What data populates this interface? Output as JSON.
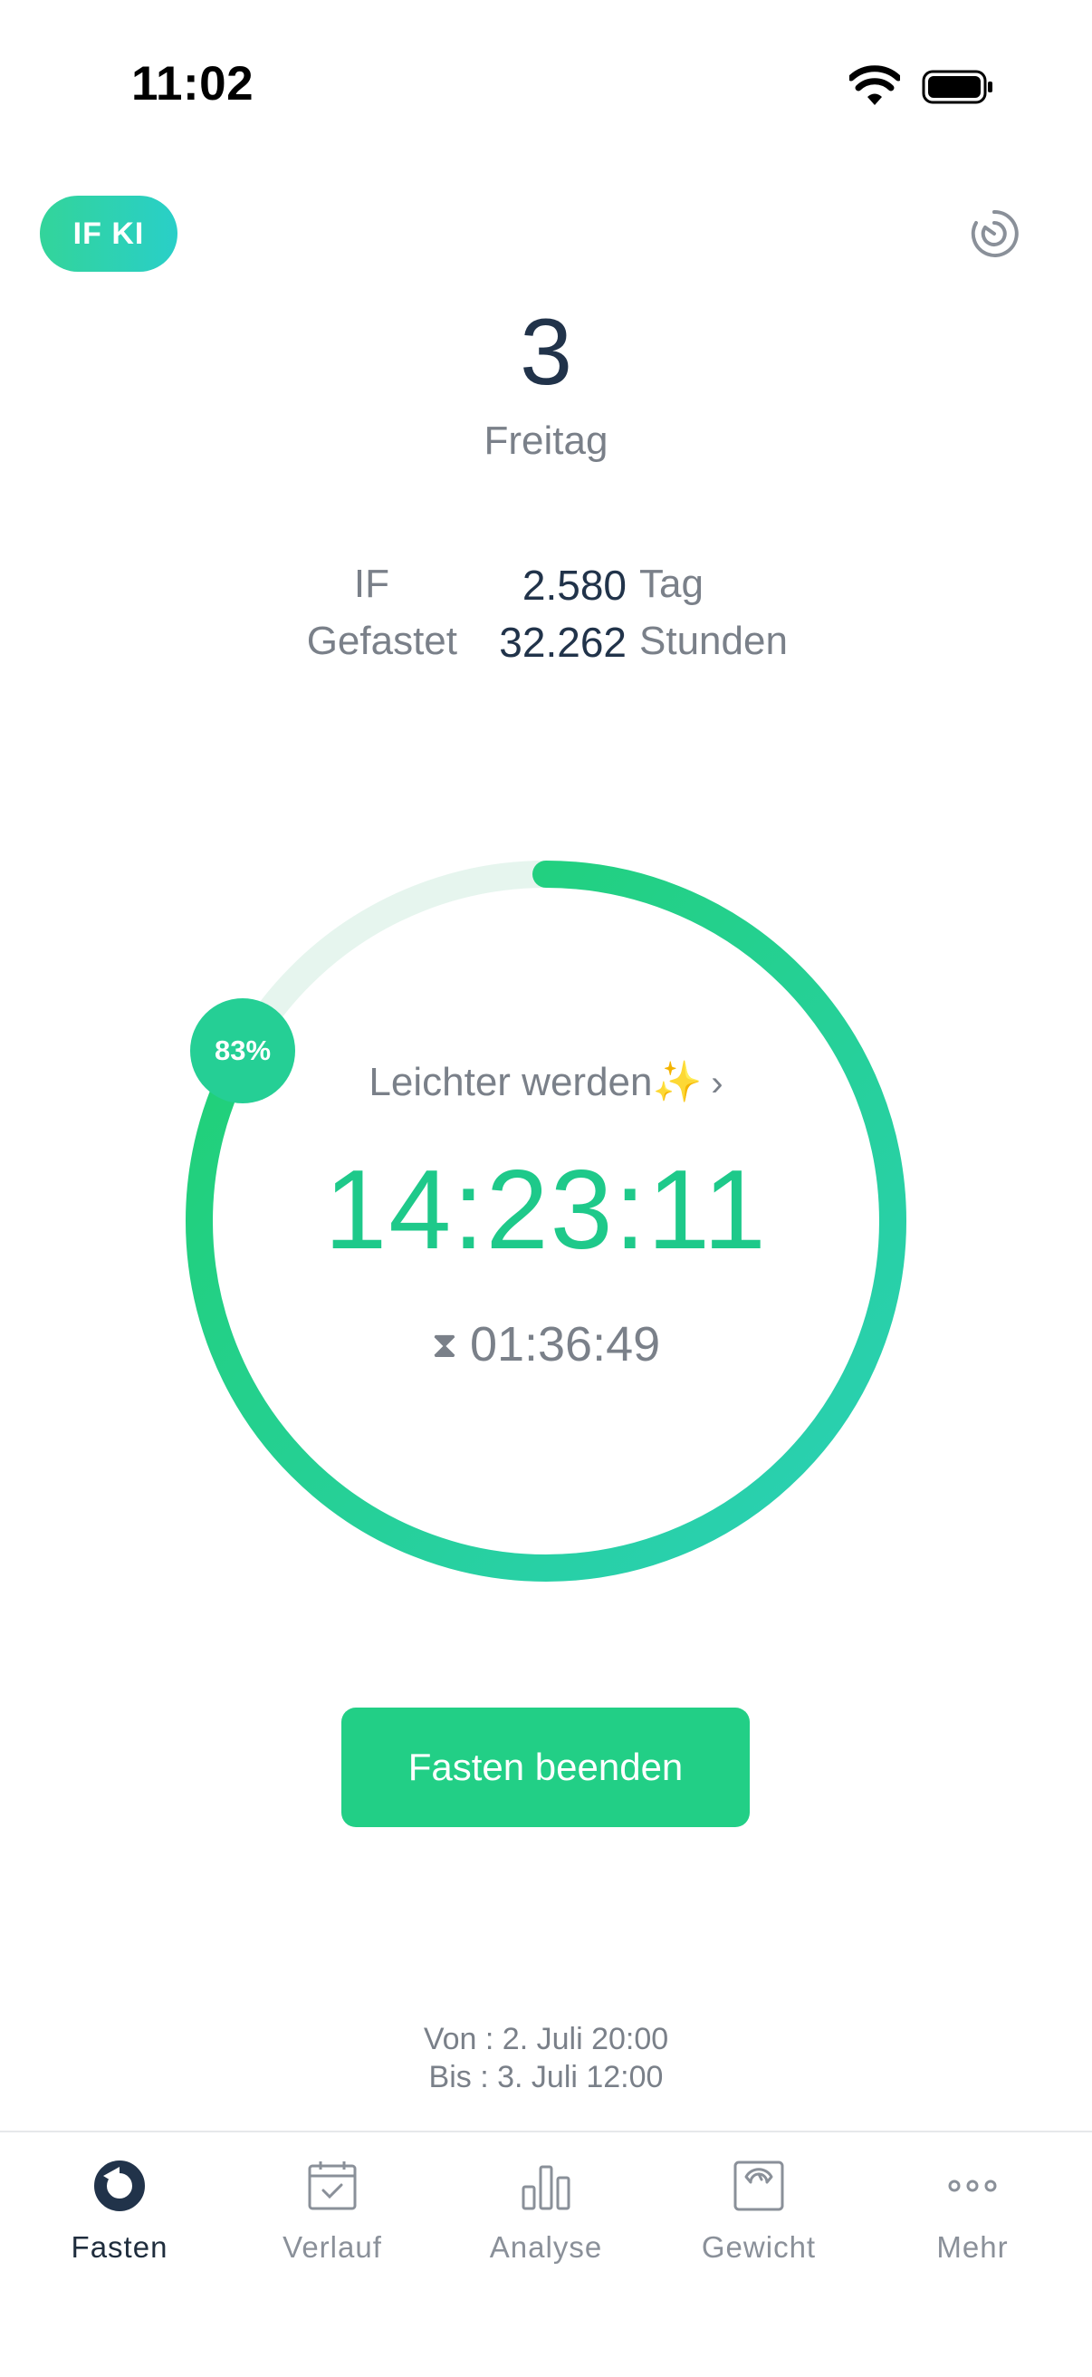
{
  "status_bar": {
    "time": "11:02"
  },
  "header": {
    "ai_badge_label": "IF KI",
    "day_number": "3",
    "day_name": "Freitag"
  },
  "stats": [
    {
      "label": "IF",
      "value": "2.580",
      "unit": "Tag"
    },
    {
      "label": "Gefastet",
      "value": "32.262",
      "unit": "Stunden"
    }
  ],
  "timer": {
    "progress_percent_label": "83%",
    "progress_fraction": 0.83,
    "phase_label": "Leichter werden✨",
    "elapsed": "14:23:11",
    "remaining": "01:36:49"
  },
  "actions": {
    "end_button_label": "Fasten beenden"
  },
  "range": {
    "from": "Von : 2. Juli 20:00",
    "to": "Bis : 3. Juli 12:00"
  },
  "tabs": [
    {
      "label": "Fasten",
      "icon": "fasting-ring-icon",
      "active": true
    },
    {
      "label": "Verlauf",
      "icon": "calendar-check-icon",
      "active": false
    },
    {
      "label": "Analyse",
      "icon": "bar-chart-icon",
      "active": false
    },
    {
      "label": "Gewicht",
      "icon": "scale-icon",
      "active": false
    },
    {
      "label": "Mehr",
      "icon": "more-dots-icon",
      "active": false
    }
  ],
  "colors": {
    "accent_green": "#22cf86",
    "gradient_start": "#2bd0b8",
    "gradient_end": "#1fd06e",
    "ring_track": "#e6f5ee",
    "text_dark": "#21334a",
    "text_muted": "#7a8089"
  }
}
